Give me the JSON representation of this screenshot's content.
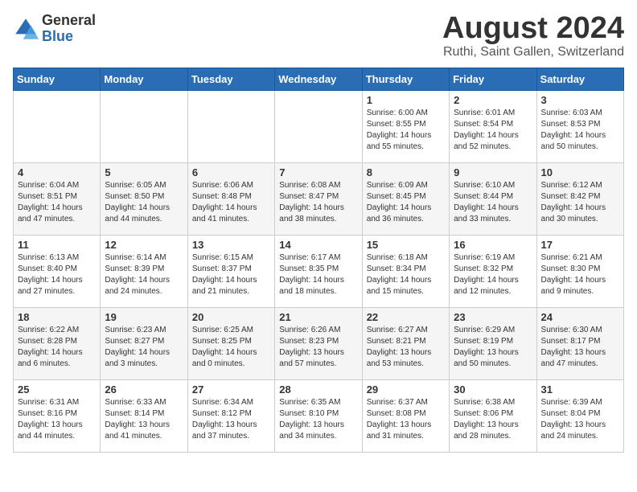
{
  "logo": {
    "general": "General",
    "blue": "Blue"
  },
  "title": "August 2024",
  "location": "Ruthi, Saint Gallen, Switzerland",
  "weekdays": [
    "Sunday",
    "Monday",
    "Tuesday",
    "Wednesday",
    "Thursday",
    "Friday",
    "Saturday"
  ],
  "weeks": [
    [
      {
        "day": "",
        "info": ""
      },
      {
        "day": "",
        "info": ""
      },
      {
        "day": "",
        "info": ""
      },
      {
        "day": "",
        "info": ""
      },
      {
        "day": "1",
        "info": "Sunrise: 6:00 AM\nSunset: 8:55 PM\nDaylight: 14 hours\nand 55 minutes."
      },
      {
        "day": "2",
        "info": "Sunrise: 6:01 AM\nSunset: 8:54 PM\nDaylight: 14 hours\nand 52 minutes."
      },
      {
        "day": "3",
        "info": "Sunrise: 6:03 AM\nSunset: 8:53 PM\nDaylight: 14 hours\nand 50 minutes."
      }
    ],
    [
      {
        "day": "4",
        "info": "Sunrise: 6:04 AM\nSunset: 8:51 PM\nDaylight: 14 hours\nand 47 minutes."
      },
      {
        "day": "5",
        "info": "Sunrise: 6:05 AM\nSunset: 8:50 PM\nDaylight: 14 hours\nand 44 minutes."
      },
      {
        "day": "6",
        "info": "Sunrise: 6:06 AM\nSunset: 8:48 PM\nDaylight: 14 hours\nand 41 minutes."
      },
      {
        "day": "7",
        "info": "Sunrise: 6:08 AM\nSunset: 8:47 PM\nDaylight: 14 hours\nand 38 minutes."
      },
      {
        "day": "8",
        "info": "Sunrise: 6:09 AM\nSunset: 8:45 PM\nDaylight: 14 hours\nand 36 minutes."
      },
      {
        "day": "9",
        "info": "Sunrise: 6:10 AM\nSunset: 8:44 PM\nDaylight: 14 hours\nand 33 minutes."
      },
      {
        "day": "10",
        "info": "Sunrise: 6:12 AM\nSunset: 8:42 PM\nDaylight: 14 hours\nand 30 minutes."
      }
    ],
    [
      {
        "day": "11",
        "info": "Sunrise: 6:13 AM\nSunset: 8:40 PM\nDaylight: 14 hours\nand 27 minutes."
      },
      {
        "day": "12",
        "info": "Sunrise: 6:14 AM\nSunset: 8:39 PM\nDaylight: 14 hours\nand 24 minutes."
      },
      {
        "day": "13",
        "info": "Sunrise: 6:15 AM\nSunset: 8:37 PM\nDaylight: 14 hours\nand 21 minutes."
      },
      {
        "day": "14",
        "info": "Sunrise: 6:17 AM\nSunset: 8:35 PM\nDaylight: 14 hours\nand 18 minutes."
      },
      {
        "day": "15",
        "info": "Sunrise: 6:18 AM\nSunset: 8:34 PM\nDaylight: 14 hours\nand 15 minutes."
      },
      {
        "day": "16",
        "info": "Sunrise: 6:19 AM\nSunset: 8:32 PM\nDaylight: 14 hours\nand 12 minutes."
      },
      {
        "day": "17",
        "info": "Sunrise: 6:21 AM\nSunset: 8:30 PM\nDaylight: 14 hours\nand 9 minutes."
      }
    ],
    [
      {
        "day": "18",
        "info": "Sunrise: 6:22 AM\nSunset: 8:28 PM\nDaylight: 14 hours\nand 6 minutes."
      },
      {
        "day": "19",
        "info": "Sunrise: 6:23 AM\nSunset: 8:27 PM\nDaylight: 14 hours\nand 3 minutes."
      },
      {
        "day": "20",
        "info": "Sunrise: 6:25 AM\nSunset: 8:25 PM\nDaylight: 14 hours\nand 0 minutes."
      },
      {
        "day": "21",
        "info": "Sunrise: 6:26 AM\nSunset: 8:23 PM\nDaylight: 13 hours\nand 57 minutes."
      },
      {
        "day": "22",
        "info": "Sunrise: 6:27 AM\nSunset: 8:21 PM\nDaylight: 13 hours\nand 53 minutes."
      },
      {
        "day": "23",
        "info": "Sunrise: 6:29 AM\nSunset: 8:19 PM\nDaylight: 13 hours\nand 50 minutes."
      },
      {
        "day": "24",
        "info": "Sunrise: 6:30 AM\nSunset: 8:17 PM\nDaylight: 13 hours\nand 47 minutes."
      }
    ],
    [
      {
        "day": "25",
        "info": "Sunrise: 6:31 AM\nSunset: 8:16 PM\nDaylight: 13 hours\nand 44 minutes."
      },
      {
        "day": "26",
        "info": "Sunrise: 6:33 AM\nSunset: 8:14 PM\nDaylight: 13 hours\nand 41 minutes."
      },
      {
        "day": "27",
        "info": "Sunrise: 6:34 AM\nSunset: 8:12 PM\nDaylight: 13 hours\nand 37 minutes."
      },
      {
        "day": "28",
        "info": "Sunrise: 6:35 AM\nSunset: 8:10 PM\nDaylight: 13 hours\nand 34 minutes."
      },
      {
        "day": "29",
        "info": "Sunrise: 6:37 AM\nSunset: 8:08 PM\nDaylight: 13 hours\nand 31 minutes."
      },
      {
        "day": "30",
        "info": "Sunrise: 6:38 AM\nSunset: 8:06 PM\nDaylight: 13 hours\nand 28 minutes."
      },
      {
        "day": "31",
        "info": "Sunrise: 6:39 AM\nSunset: 8:04 PM\nDaylight: 13 hours\nand 24 minutes."
      }
    ]
  ]
}
